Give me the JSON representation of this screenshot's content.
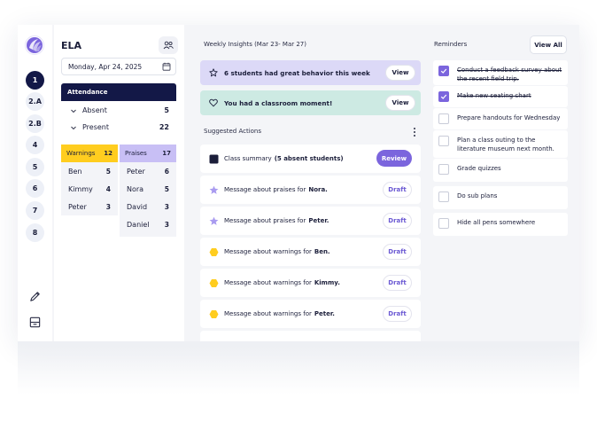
{
  "rail": {
    "items": [
      "1",
      "2.A",
      "2.B",
      "4",
      "5",
      "6",
      "7",
      "8"
    ],
    "active_index": 0
  },
  "class_panel": {
    "title": "ELA",
    "date": "Monday, Apr 24, 2025",
    "attendance": {
      "header": "Attendance",
      "rows": [
        {
          "label": "Absent",
          "count": "5"
        },
        {
          "label": "Present",
          "count": "22"
        }
      ]
    },
    "warnings": {
      "label": "Warnings",
      "count": "12",
      "students": [
        {
          "name": "Ben",
          "count": "5"
        },
        {
          "name": "Kimmy",
          "count": "4"
        },
        {
          "name": "Peter",
          "count": "3"
        }
      ]
    },
    "praises": {
      "label": "Praises",
      "count": "17",
      "students": [
        {
          "name": "Peter",
          "count": "6"
        },
        {
          "name": "Nora",
          "count": "5"
        },
        {
          "name": "David",
          "count": "3"
        },
        {
          "name": "Daniel",
          "count": "3"
        }
      ]
    }
  },
  "insights": {
    "title": "Weekly Insights (Mar 23- Mar 27)",
    "banners": [
      {
        "text": "6 students had great behavior this week",
        "button": "View"
      },
      {
        "text": "You had a classroom moment!",
        "button": "View"
      }
    ]
  },
  "actions": {
    "title": "Suggested Actions",
    "summary": {
      "text": "Class summary",
      "highlight": "(5 absent students)",
      "button": "Review"
    },
    "items": [
      {
        "text": "Message about praises for",
        "name": "Nora.",
        "kind": "praise",
        "button": "Draft"
      },
      {
        "text": "Message about praises for",
        "name": "Peter.",
        "kind": "praise",
        "button": "Draft"
      },
      {
        "text": "Message about warnings for",
        "name": "Ben.",
        "kind": "warning",
        "button": "Draft"
      },
      {
        "text": "Message about warnings for",
        "name": "Kimmy.",
        "kind": "warning",
        "button": "Draft"
      },
      {
        "text": "Message about warnings for",
        "name": "Peter.",
        "kind": "warning",
        "button": "Draft"
      }
    ]
  },
  "reminders": {
    "title": "Reminders",
    "view_all": "View All",
    "items": [
      {
        "text": "Conduct a feedback survey about the recent field trip.",
        "done": true
      },
      {
        "text": "Make new seating chart",
        "done": true
      },
      {
        "text": "Prepare handouts for Wednesday",
        "done": false
      },
      {
        "text": "Plan a class outing to the literature museum next month.",
        "done": false
      },
      {
        "text": "Grade quizzes",
        "done": false
      },
      {
        "text": "Do sub plans",
        "done": false
      },
      {
        "text": "Hide all pens somewhere",
        "done": false
      }
    ]
  },
  "colors": {
    "navy": "#131847",
    "accent": "#7b65dd",
    "warning": "#ffcd1f",
    "praise": "#c8bff5",
    "insight_purple": "#dcd9f7",
    "insight_teal": "#cdeae3"
  }
}
